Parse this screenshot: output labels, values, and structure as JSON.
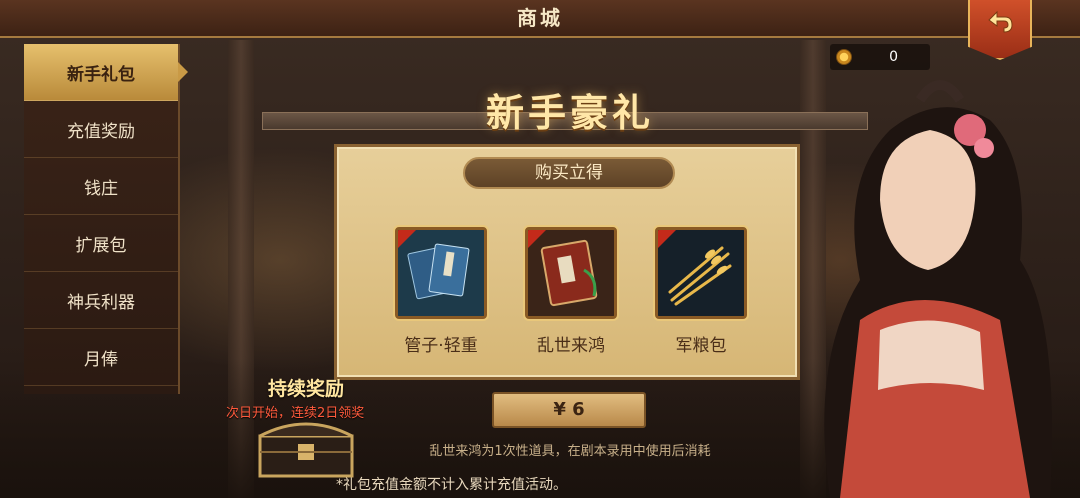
{
  "header": {
    "title": "商城"
  },
  "sidebar": {
    "items": [
      {
        "label": "新手礼包",
        "active": true
      },
      {
        "label": "充值奖励",
        "active": false
      },
      {
        "label": "钱庄",
        "active": false
      },
      {
        "label": "扩展包",
        "active": false
      },
      {
        "label": "神兵利器",
        "active": false
      },
      {
        "label": "月俸",
        "active": false
      }
    ]
  },
  "currency": {
    "icon": "coin-icon",
    "value": "0"
  },
  "main": {
    "heading": "新手豪礼",
    "subheading": "购买立得",
    "items": [
      {
        "label": "管子·轻重",
        "icon": "book-icon"
      },
      {
        "label": "乱世来鸿",
        "icon": "scroll-icon"
      },
      {
        "label": "军粮包",
        "icon": "wheat-icon"
      }
    ],
    "price": "¥ 6",
    "note": "乱世来鸿为1次性道具，在剧本录用中使用后消耗"
  },
  "reward": {
    "title": "持续奖励",
    "subtitle": "次日开始，连续2日领奖"
  },
  "footnote": "*礼包充值金额不计入累计充值活动。",
  "colors": {
    "accent": "#e6c06d",
    "header_bg": "#5a3420",
    "alert": "#ff5a3c"
  }
}
